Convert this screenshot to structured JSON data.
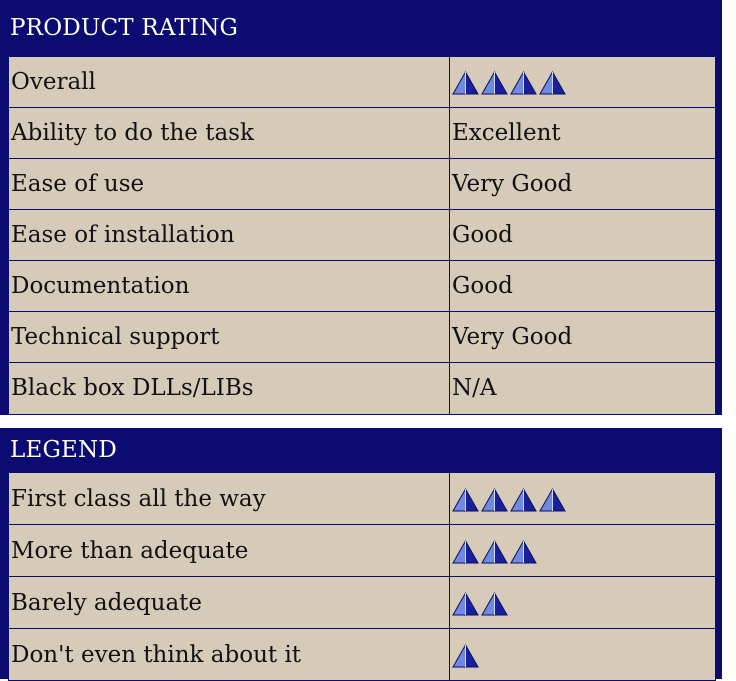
{
  "rating": {
    "title": "PRODUCT RATING",
    "rows": [
      {
        "label": "Overall",
        "pyramids": 4
      },
      {
        "label": "Ability to do the task",
        "value": "Excellent"
      },
      {
        "label": "Ease of use",
        "value": "Very Good"
      },
      {
        "label": "Ease of installation",
        "value": "Good"
      },
      {
        "label": "Documentation",
        "value": "Good"
      },
      {
        "label": "Technical support",
        "value": "Very Good"
      },
      {
        "label": "Black box DLLs/LIBs",
        "value": "N/A"
      }
    ]
  },
  "legend": {
    "title": "LEGEND",
    "rows": [
      {
        "label": "First class all the way",
        "pyramids": 4
      },
      {
        "label": "More than adequate",
        "pyramids": 3
      },
      {
        "label": "Barely adequate",
        "pyramids": 2
      },
      {
        "label": "Don't even think about it",
        "pyramids": 1
      }
    ]
  },
  "icons": {
    "rating_icon": "pyramid-icon",
    "pyramid_color_light": "#6f8ae0",
    "pyramid_color_dark": "#1a1f9c"
  },
  "colors": {
    "header_bg": "#0b0b72",
    "cell_bg": "#d6cab9"
  }
}
